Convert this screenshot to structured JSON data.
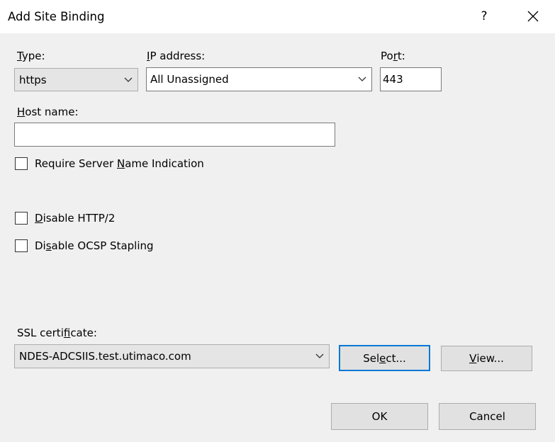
{
  "window": {
    "title": "Add Site Binding",
    "help_label": "?"
  },
  "form": {
    "type_label": {
      "pre": "",
      "accel": "T",
      "post": "ype:"
    },
    "type_value": "https",
    "ip_label": {
      "pre": "",
      "accel": "I",
      "post": "P address:"
    },
    "ip_value": "All Unassigned",
    "port_label": {
      "pre": "Po",
      "accel": "r",
      "post": "t:"
    },
    "port_value": "443",
    "host_label": {
      "pre": "",
      "accel": "H",
      "post": "ost name:"
    },
    "host_value": "",
    "sni": {
      "pre": "Require Server ",
      "accel": "N",
      "post": "ame Indication",
      "checked": false
    },
    "http2": {
      "pre": "",
      "accel": "D",
      "post": "isable HTTP/2",
      "checked": false
    },
    "ocsp": {
      "pre": "Di",
      "accel": "s",
      "post": "able OCSP Stapling",
      "checked": false
    },
    "ssl_label": {
      "pre": "SSL certi",
      "accel": "f",
      "post": "icate:"
    },
    "ssl_value": "NDES-ADCSIIS.test.utimaco.com"
  },
  "buttons": {
    "select": {
      "pre": "Sel",
      "accel": "e",
      "post": "ct..."
    },
    "view": {
      "pre": "",
      "accel": "V",
      "post": "iew..."
    },
    "ok": "OK",
    "cancel": "Cancel"
  },
  "colors": {
    "focus_border": "#0078d7",
    "dialog_bg": "#f0f0f0",
    "title_bg": "#ffffff"
  }
}
